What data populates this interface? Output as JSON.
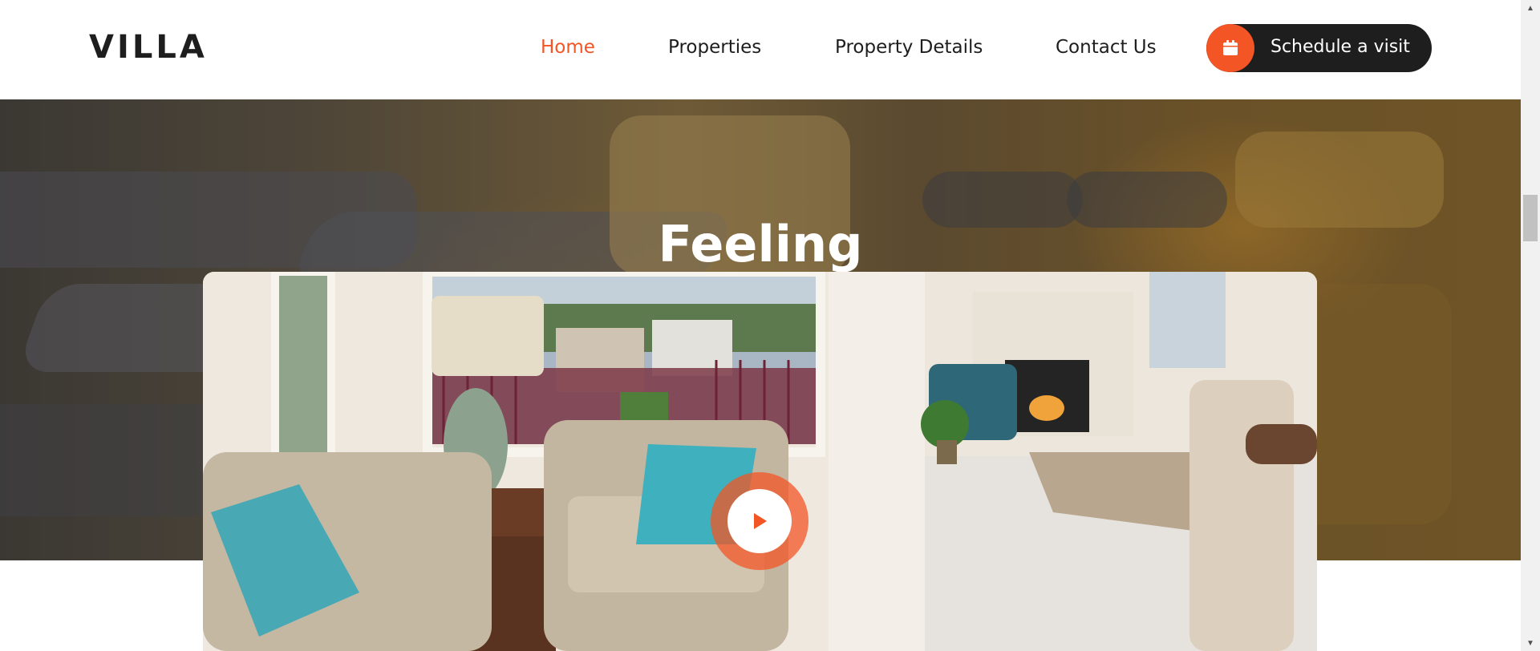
{
  "header": {
    "logo": "VILLA",
    "nav": [
      {
        "label": "Home",
        "active": true
      },
      {
        "label": "Properties",
        "active": false
      },
      {
        "label": "Property Details",
        "active": false
      },
      {
        "label": "Contact Us",
        "active": false
      }
    ],
    "schedule_button": {
      "label": "Schedule a visit",
      "icon": "calendar-icon"
    }
  },
  "hero": {
    "title": "Feeling"
  },
  "video": {
    "play_icon": "play-icon"
  },
  "colors": {
    "accent": "#f35525",
    "dark": "#1e1e1e",
    "white": "#ffffff"
  }
}
